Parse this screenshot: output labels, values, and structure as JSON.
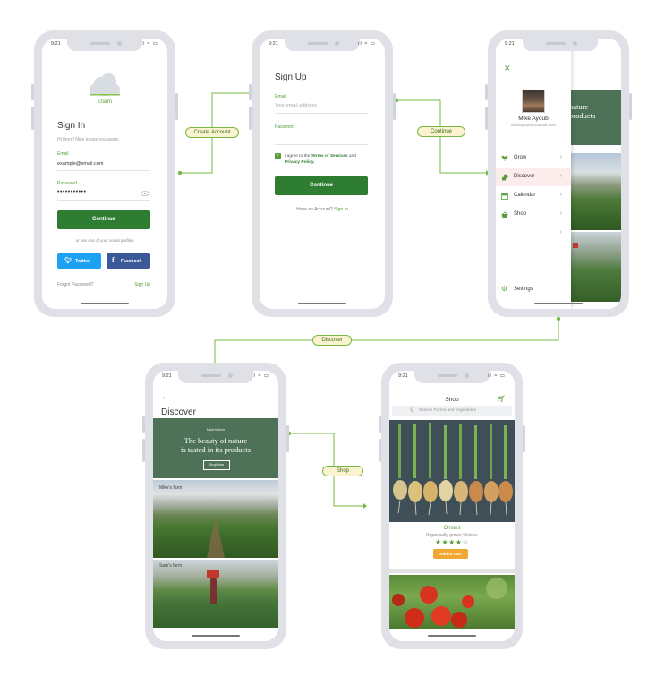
{
  "status_time": "9:21",
  "status_icons": "ıl ≈ ▭",
  "connectors": {
    "create_account": "Create Account",
    "continue": "Continue",
    "discover": "Discover",
    "shop": "Shop"
  },
  "signin": {
    "logo_text": "Efarm",
    "title": "Sign In",
    "subtitle": "Hi there! Nice to see you again.",
    "email_label": "Email",
    "email_value": "example@email.com",
    "password_label": "Password",
    "password_value": "•••••••••••",
    "continue_label": "Continue",
    "social_text": "or use one of your social profiles",
    "twitter_label": "Twitter",
    "facebook_label": "Facebook",
    "forgot_label": "Forgot Password?",
    "signup_label": "Sign Up"
  },
  "signup": {
    "title": "Sign Up",
    "email_label": "Email",
    "email_placeholder": "Your email address",
    "password_label": "Password",
    "agree_prefix": "I agree to the ",
    "terms_label": "Terms of Services",
    "and_text": " and",
    "privacy_label": "Privacy Policy.",
    "continue_label": "Continue",
    "have_account": "Have an Account?",
    "signin_label": "Sign In"
  },
  "drawer": {
    "user_name": "Mike Ayoub",
    "user_email": "mikeayoub@outlook.com",
    "items": [
      {
        "label": "Grow",
        "icon": "sprout-icon"
      },
      {
        "label": "Discover",
        "icon": "discover-icon",
        "active": true
      },
      {
        "label": "Calendar",
        "icon": "calendar-icon"
      },
      {
        "label": "Shop",
        "icon": "basket-icon"
      }
    ],
    "settings_label": "Settings",
    "bg_headline": "nature\nproducts"
  },
  "discover": {
    "title": "Discover",
    "banner_small": "Mike's farm",
    "banner_line1": "The beauty of nature",
    "banner_line2": "is tasted in its products",
    "banner_button": "Shop Now",
    "farm1_label": "Mike's farm",
    "farm2_label": "Sam's farm"
  },
  "shop": {
    "title": "Shop",
    "search_placeholder": "Search Farms and vegetables",
    "product_name": "Onions",
    "product_desc": "Organically grown Onions.",
    "product_stars": "★★★★☆",
    "add_to_cart": "Add to Cart"
  },
  "colors": {
    "primary": "#2e7d32",
    "accent_green": "#5a9e3a",
    "twitter": "#1da1f2",
    "facebook": "#3b5998",
    "cart_button": "#f0a832",
    "banner_bg": "#4d7258",
    "active_menu_bg": "#fdecec"
  }
}
